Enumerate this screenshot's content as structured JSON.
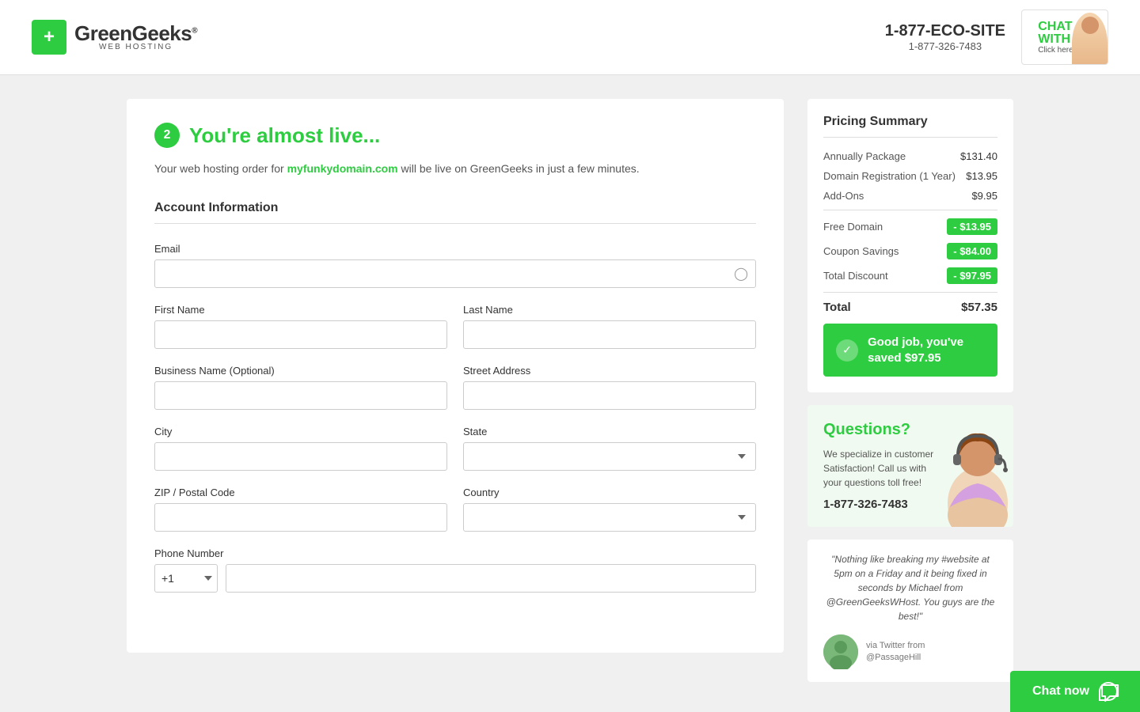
{
  "header": {
    "logo_name": "GreenGeeks",
    "logo_sup": "®",
    "logo_sub": "WEB HOSTING",
    "phone_main": "1-877-ECO-SITE",
    "phone_alt": "1-877-326-7483",
    "chat_line1": "CHAT",
    "chat_line2": "WITH US",
    "chat_line3": "Click here"
  },
  "form": {
    "step_number": "2",
    "heading": "You're almost live...",
    "subtitle_pre": "Your web hosting order for ",
    "domain": "myfunkydomain.com",
    "subtitle_post": " will be live on GreenGeeks in just a few minutes.",
    "section_title": "Account Information",
    "email_label": "Email",
    "firstname_label": "First Name",
    "lastname_label": "Last Name",
    "business_label": "Business Name (Optional)",
    "street_label": "Street Address",
    "city_label": "City",
    "state_label": "State",
    "zip_label": "ZIP / Postal Code",
    "country_label": "Country",
    "phone_label": "Phone Number",
    "phone_prefix": "+1"
  },
  "pricing": {
    "title": "Pricing Summary",
    "rows": [
      {
        "label": "Annually Package",
        "value": "$131.40",
        "badge": false
      },
      {
        "label": "Domain Registration (1 Year)",
        "value": "$13.95",
        "badge": false
      },
      {
        "label": "Add-Ons",
        "value": "$9.95",
        "badge": false
      },
      {
        "label": "Free Domain",
        "value": "- $13.95",
        "badge": true
      },
      {
        "label": "Coupon Savings",
        "value": "- $84.00",
        "badge": true
      },
      {
        "label": "Total Discount",
        "value": "- $97.95",
        "badge": true
      },
      {
        "label": "Total",
        "value": "$57.35",
        "badge": false,
        "divider": true
      }
    ],
    "savings_text": "Good job, you've saved $97.95"
  },
  "questions": {
    "title": "Questions?",
    "text": "We specialize in customer Satisfaction! Call us with your questions toll free!",
    "phone": "1-877-326-7483"
  },
  "testimonial": {
    "quote": "\"Nothing like breaking my #website at 5pm on a Friday and it being fixed in seconds by Michael from @GreenGeeksWHost. You guys are the best!\"",
    "source": "via Twitter from\n@PassageHill"
  },
  "chat": {
    "label": "Chat now"
  }
}
